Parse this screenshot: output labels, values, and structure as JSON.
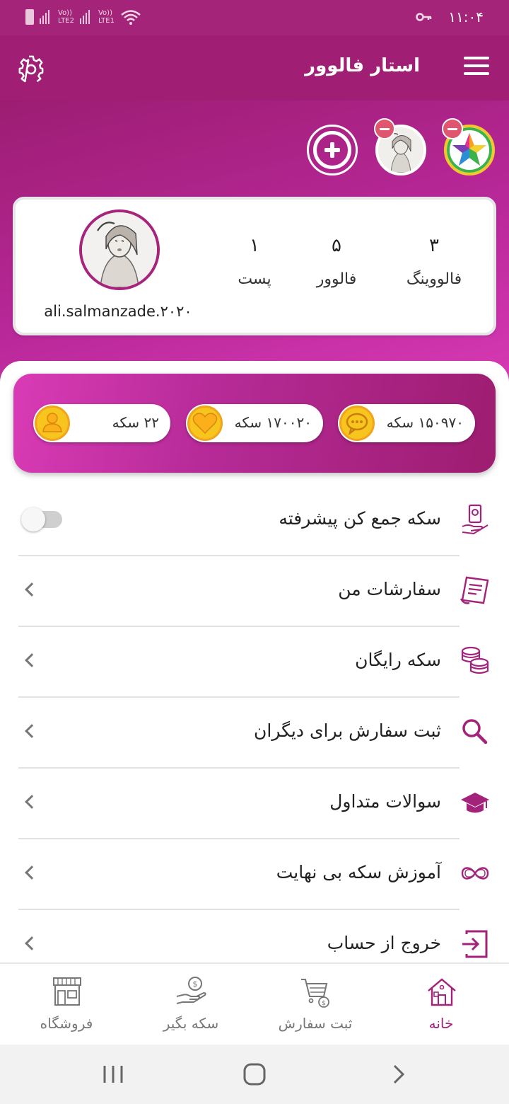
{
  "status_bar": {
    "time": "۱۱:۰۴",
    "sim1": "LTE2",
    "sim2": "LTE1",
    "volte": "Vo))"
  },
  "app_bar": {
    "title": "استار فالوور",
    "menu_icon": "hamburger-menu-icon",
    "settings_icon": "gear-icon"
  },
  "accounts": {
    "items": [
      {
        "icon": "star-logo-avatar"
      },
      {
        "icon": "user-sketch-avatar"
      }
    ],
    "add_icon": "plus-circle-icon"
  },
  "profile": {
    "username": "ali.salmanzade.۲۰۲۰",
    "stats": [
      {
        "value": "۳",
        "label": "فالووینگ"
      },
      {
        "value": "۵",
        "label": "فالوور"
      },
      {
        "value": "۱",
        "label": "پست"
      }
    ]
  },
  "coins": [
    {
      "text": "۱۵۰۹۷۰ سکه",
      "icon": "comment-coin-icon"
    },
    {
      "text": "۱۷۰۰۲۰ سکه",
      "icon": "heart-coin-icon"
    },
    {
      "text": "۲۲ سکه",
      "icon": "follower-coin-icon"
    }
  ],
  "menu": [
    {
      "label": "سکه جمع کن پیشرفته",
      "icon": "auto-collect-icon",
      "control": "toggle",
      "toggle_on": false
    },
    {
      "label": "سفارشات من",
      "icon": "orders-list-icon",
      "control": "chevron"
    },
    {
      "label": "سکه رایگان",
      "icon": "coin-stack-icon",
      "control": "chevron"
    },
    {
      "label": "ثبت سفارش برای دیگران",
      "icon": "search-icon",
      "control": "chevron"
    },
    {
      "label": "سوالات متداول",
      "icon": "graduation-cap-icon",
      "control": "chevron"
    },
    {
      "label": "آموزش سکه بی نهایت",
      "icon": "infinity-icon",
      "control": "chevron"
    },
    {
      "label": "خروج از حساب",
      "icon": "logout-icon",
      "control": "chevron"
    }
  ],
  "bottom_nav": [
    {
      "label": "خانه",
      "icon": "home-icon",
      "active": true
    },
    {
      "label": "ثبت سفارش",
      "icon": "cart-icon",
      "active": false
    },
    {
      "label": "سکه بگیر",
      "icon": "coin-hand-icon",
      "active": false
    },
    {
      "label": "فروشگاه",
      "icon": "store-icon",
      "active": false
    }
  ],
  "colors": {
    "primary": "#a01f74",
    "accent_pink": "#d93bb6",
    "coin_gold": "#f7c51e",
    "icon_purple": "#a4237a"
  }
}
